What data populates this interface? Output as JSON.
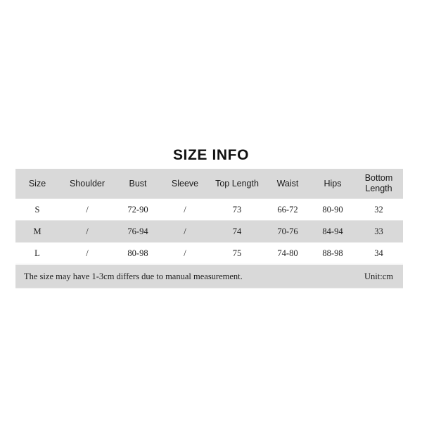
{
  "title": "SIZE INFO",
  "colors": {
    "page_background": "#ffffff",
    "header_background": "#d9d9d9",
    "row_alt_background": "#d9d9d9",
    "row_background": "#ffffff",
    "text": "#1d1d1d",
    "separator": "#e6e6e6"
  },
  "table": {
    "columns": [
      "Size",
      "Shoulder",
      "Bust",
      "Sleeve",
      "Top Length",
      "Waist",
      "Hips",
      "Bottom Length"
    ],
    "rows": [
      {
        "size": "S",
        "shoulder": "/",
        "bust": "72-90",
        "sleeve": "/",
        "top_length": "73",
        "waist": "66-72",
        "hips": "80-90",
        "bottom_length": "32"
      },
      {
        "size": "M",
        "shoulder": "/",
        "bust": "76-94",
        "sleeve": "/",
        "top_length": "74",
        "waist": "70-76",
        "hips": "84-94",
        "bottom_length": "33"
      },
      {
        "size": "L",
        "shoulder": "/",
        "bust": "80-98",
        "sleeve": "/",
        "top_length": "75",
        "waist": "74-80",
        "hips": "88-98",
        "bottom_length": "34"
      }
    ]
  },
  "footer": {
    "note": "The size may have 1-3cm differs due to manual measurement.",
    "unit": "Unit:cm"
  }
}
